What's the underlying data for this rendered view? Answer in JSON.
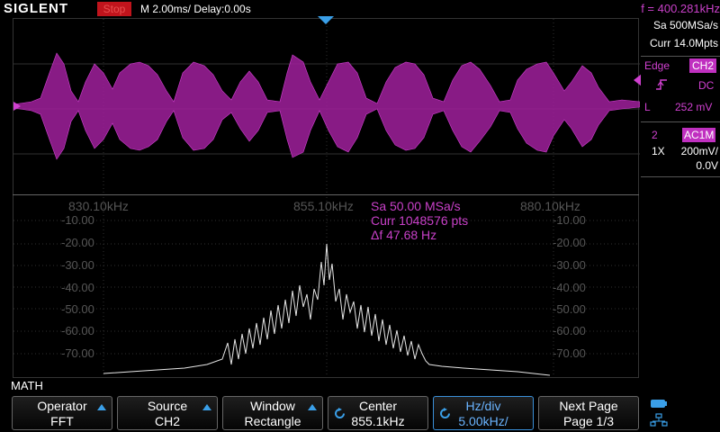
{
  "header": {
    "brand": "SIGLENT",
    "run_state": "Stop",
    "timebase": "M 2.00ms/ Delay:0.00s",
    "frequency": "f = 400.281kHz"
  },
  "acquisition": {
    "sample_rate": "Sa 500MSa/s",
    "memory": "Curr 14.0Mpts"
  },
  "trigger": {
    "type": "Edge",
    "source": "CH2",
    "coupling": "DC",
    "level_label": "L",
    "level": "252 mV"
  },
  "channel": {
    "number": "2",
    "coupling": "AC1M",
    "probe": "1X",
    "scale": "200mV/",
    "offset": "0.0V"
  },
  "fft": {
    "freq_labels": [
      "830.10kHz",
      "855.10kHz",
      "880.10kHz"
    ],
    "db_labels": [
      "-10.00",
      "-20.00",
      "-30.00",
      "-40.00",
      "-50.00",
      "-60.00",
      "-70.00"
    ],
    "right_db_labels": [
      "-10.00",
      "-20.00",
      "-30.00",
      "-40.00",
      "-50.00",
      "-60.00",
      "-70.00"
    ],
    "sa": "Sa 50.00 MSa/s",
    "curr": "Curr 1048576 pts",
    "df": "Δf 47.68 Hz"
  },
  "math_label": "MATH",
  "menu": [
    {
      "top": "Operator",
      "bottom": "FFT"
    },
    {
      "top": "Source",
      "bottom": "CH2"
    },
    {
      "top": "Window",
      "bottom": "Rectangle"
    },
    {
      "top": "Center",
      "bottom": "855.1kHz"
    },
    {
      "top": "Hz/div",
      "bottom": "5.00kHz/"
    },
    {
      "top": "Next Page",
      "bottom": "Page 1/3"
    }
  ],
  "colors": {
    "ch2": "#c030c0",
    "math": "#e6e6e6",
    "accent": "#3a9fe8",
    "stop": "#c0141c"
  },
  "icons": [
    "trigger-rising-edge-icon",
    "knob-icon",
    "usb-icon",
    "network-icon"
  ]
}
